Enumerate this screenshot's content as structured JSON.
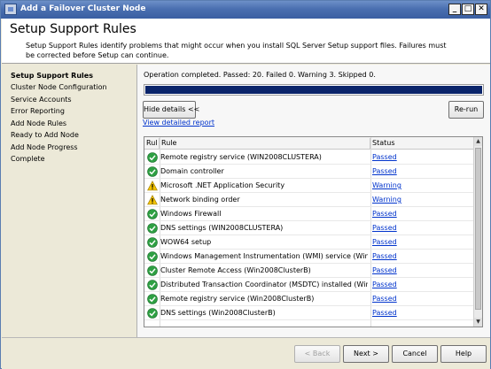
{
  "window": {
    "title": "Add a Failover Cluster Node",
    "minimize": "_",
    "maximize": "□",
    "close": "✕"
  },
  "header": {
    "title": "Setup Support Rules",
    "description": "Setup Support Rules identify problems that might occur when you install SQL Server Setup support files. Failures must be corrected before Setup can continue."
  },
  "sidebar": {
    "items": [
      {
        "label": "Setup Support Rules",
        "active": true
      },
      {
        "label": "Cluster Node Configuration",
        "active": false
      },
      {
        "label": "Service Accounts",
        "active": false
      },
      {
        "label": "Error Reporting",
        "active": false
      },
      {
        "label": "Add Node Rules",
        "active": false
      },
      {
        "label": "Ready to Add Node",
        "active": false
      },
      {
        "label": "Add Node Progress",
        "active": false
      },
      {
        "label": "Complete",
        "active": false
      }
    ]
  },
  "main": {
    "status_text": "Operation completed.  Passed: 20.   Failed 0.   Warning 3.   Skipped 0.",
    "progress": 1.0,
    "hide_details_label": "Hide details <<",
    "rerun_label": "Re-run",
    "view_report_label": "View detailed report"
  },
  "grid": {
    "columns": [
      "Rul",
      "Rule",
      "Status"
    ],
    "rows": [
      {
        "icon": "passed-icon",
        "rule": "Remote registry service (WIN2008CLUSTERA)",
        "status": "Passed"
      },
      {
        "icon": "passed-icon",
        "rule": "Domain controller",
        "status": "Passed"
      },
      {
        "icon": "warning-icon",
        "rule": "Microsoft .NET Application Security",
        "status": "Warning"
      },
      {
        "icon": "warning-icon",
        "rule": "Network binding order",
        "status": "Warning"
      },
      {
        "icon": "passed-icon",
        "rule": "Windows Firewall",
        "status": "Passed"
      },
      {
        "icon": "passed-icon",
        "rule": "DNS settings (WIN2008CLUSTERA)",
        "status": "Passed"
      },
      {
        "icon": "passed-icon",
        "rule": "WOW64 setup",
        "status": "Passed"
      },
      {
        "icon": "passed-icon",
        "rule": "Windows Management Instrumentation (WMI) service (Win2008Clus...",
        "status": "Passed"
      },
      {
        "icon": "passed-icon",
        "rule": "Cluster Remote Access (Win2008ClusterB)",
        "status": "Passed"
      },
      {
        "icon": "passed-icon",
        "rule": "Distributed Transaction Coordinator (MSDTC) installed (Win2008Clus...",
        "status": "Passed"
      },
      {
        "icon": "passed-icon",
        "rule": "Remote registry service (Win2008ClusterB)",
        "status": "Passed"
      },
      {
        "icon": "passed-icon",
        "rule": "DNS settings (Win2008ClusterB)",
        "status": "Passed"
      }
    ]
  },
  "footer": {
    "back_label": "< Back",
    "next_label": "Next >",
    "cancel_label": "Cancel",
    "help_label": "Help"
  },
  "colors": {
    "passed": "#2ea043",
    "warning": "#f2c200",
    "link": "#0033cc",
    "progress": "#0a246a"
  }
}
